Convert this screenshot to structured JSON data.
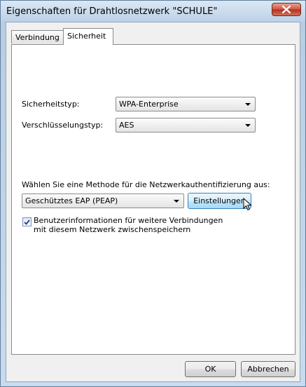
{
  "window": {
    "title": "Eigenschaften für Drahtlosnetzwerk \"SCHULE\"",
    "close_label": "X"
  },
  "tabs": [
    {
      "label": "Verbindung",
      "active": false
    },
    {
      "label": "Sicherheit",
      "active": true
    }
  ],
  "security": {
    "type_label": "Sicherheitstyp:",
    "type_value": "WPA-Enterprise",
    "encryption_label": "Verschlüsselungstyp:",
    "encryption_value": "AES"
  },
  "auth": {
    "instruction": "Wählen Sie eine Methode für die Netzwerkauthentifizierung aus:",
    "method_value": "Geschütztes EAP (PEAP)",
    "settings_button": "Einstellungen",
    "remember_checked": true,
    "remember_label": "Benutzerinformationen für weitere Verbindungen mit diesem Netzwerk zwischenspeichern"
  },
  "footer": {
    "ok_label": "OK",
    "cancel_label": "Abbrechen"
  }
}
